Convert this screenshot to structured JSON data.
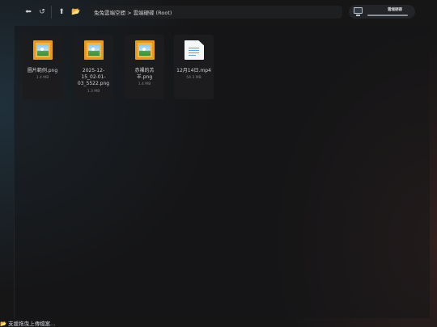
{
  "toolbar": {
    "back_icon": "⬅",
    "refresh_icon": "↺",
    "up_icon": "⬆",
    "folder_icon": "📂"
  },
  "breadcrumb": {
    "text": "兔兔雲端空間 > 雲端硬碟 (Root)"
  },
  "storage": {
    "label": "雲端硬碟",
    "used_fraction": 1.0,
    "icon": "monitor-icon"
  },
  "files": [
    {
      "name": "圖片範例.png",
      "size": "1.4 MB",
      "type": "image"
    },
    {
      "name": "2025-12-15_02-01-03_5522.png",
      "size": "1.3 MB",
      "type": "image",
      "display_lines": [
        "2025-12-",
        "15_02-01-",
        "03_5522.png"
      ]
    },
    {
      "name": "赤裸的羔羊.png",
      "size": "1.4 MB",
      "type": "image",
      "display_lines": [
        "赤裸的羔",
        "羊.png"
      ]
    },
    {
      "name": "12月14日.mp4",
      "size": "54.3 MB",
      "type": "document"
    }
  ],
  "status": {
    "icon": "📂",
    "text": "支援拖曳上傳檔案..."
  },
  "colors": {
    "background": "#161617",
    "tile": "#1c1c1e",
    "image_frame": "#e49a2a",
    "accent_text": "#cfd2d6"
  }
}
